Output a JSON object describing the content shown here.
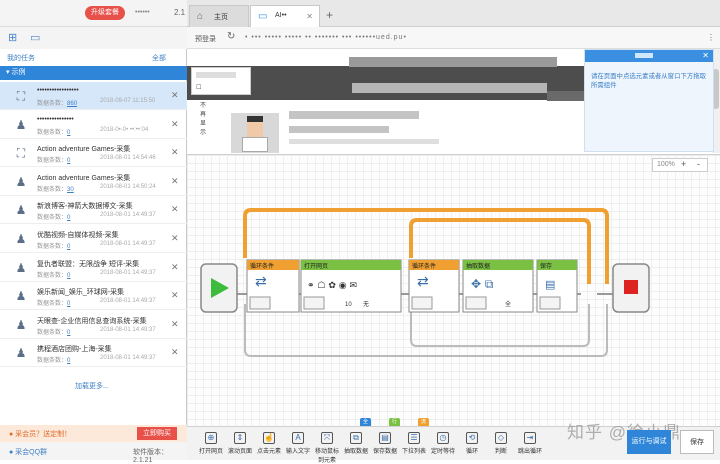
{
  "sidebar": {
    "upgrade_label": "升级套餐",
    "user_name": "••••••",
    "version_top": "2.1",
    "my_tasks": "我的任务",
    "tools_right": "全部",
    "group_name": "示例",
    "tasks": [
      {
        "name": "•••••••••••••••••",
        "count_label": "数据条数：",
        "count": "860",
        "date": "2018-09-07 11:15:50",
        "icon": "flowchart-icon"
      },
      {
        "name": "•••••••••••••••",
        "count_label": "数据条数：",
        "count": "0",
        "date": "2018-0•-0• ••:••:04",
        "icon": "robot-icon"
      },
      {
        "name": "Action adventure Games-采集",
        "count_label": "数据条数：",
        "count": "0",
        "date": "2018-08-01 14:54:46",
        "icon": "flowchart-icon"
      },
      {
        "name": "Action adventure Games-采集",
        "count_label": "数据条数：",
        "count": "30",
        "date": "2018-08-01 14:50:24",
        "icon": "robot-icon"
      },
      {
        "name": "新浪博客-神箭大数据博文-采集",
        "count_label": "数据条数：",
        "count": "0",
        "date": "2018-08-01 14:49:37",
        "icon": "robot-icon"
      },
      {
        "name": "优酷视频-自媒体视频-采集",
        "count_label": "数据条数：",
        "count": "0",
        "date": "2018-08-01 14:49:37",
        "icon": "robot-icon"
      },
      {
        "name": "复仇者联盟：无限战争 短评-采集",
        "count_label": "数据条数：",
        "count": "0",
        "date": "2018-08-01 14:49:37",
        "icon": "robot-icon"
      },
      {
        "name": "娱乐新闻_娱乐_环球网-采集",
        "count_label": "数据条数：",
        "count": "0",
        "date": "2018-08-01 14:49:37",
        "icon": "robot-icon"
      },
      {
        "name": "天眼查-企业信用信息查询系统-采集",
        "count_label": "数据条数：",
        "count": "0",
        "date": "2018-08-01 14:49:37",
        "icon": "robot-icon"
      },
      {
        "name": "携程酒店团购-上海-采集",
        "count_label": "数据条数：",
        "count": "0",
        "date": "2018-08-01 14:49:37",
        "icon": "robot-icon"
      }
    ],
    "load_more": "加载更多...",
    "promo_text": "● 采会员？送定制！",
    "buy_label": "立即购买",
    "qq_group": "● 采会QQ群",
    "software_version": "软件版本：2.1.21"
  },
  "tabs": [
    {
      "label": "主页",
      "icon": "home-icon"
    },
    {
      "label": "AI••",
      "icon": "browser-icon"
    }
  ],
  "address": {
    "login": "预登录",
    "url": "• ••• ••••• ••••• •• ••••••• ••• ••••••ued.pu•"
  },
  "hide_box_label": "不再显示",
  "tip_text": "请在页面中点选元素或者从窗口下方拖取所需组件",
  "zoom": {
    "level": "100%",
    "plus": "+",
    "minus": "-"
  },
  "nodes": {
    "loop1": "循环条件",
    "open_page": "打开网页",
    "loop2": "循环条件",
    "extract": "抽取数据",
    "save": "保存",
    "open_page_num": "10",
    "open_page_unit": "无",
    "extract_badge": "全"
  },
  "toolbar_tags": [
    {
      "label": "全部组件",
      "color": "#2f86d8"
    },
    {
      "label": "行为控制",
      "color": "#7ac143"
    },
    {
      "label": "流程控制",
      "color": "#f0a030"
    }
  ],
  "toolbar": [
    "打开网页",
    "滚动页面",
    "点击元素",
    "输入文字",
    "移动鼠标到元素",
    "抽取数据",
    "保存数据",
    "下拉列表",
    "定时等待",
    "循环",
    "判断",
    "跳出循环"
  ],
  "run_label": "运行与调试",
  "save_label": "保存",
  "watermark": "知乎 @徐小鼎"
}
